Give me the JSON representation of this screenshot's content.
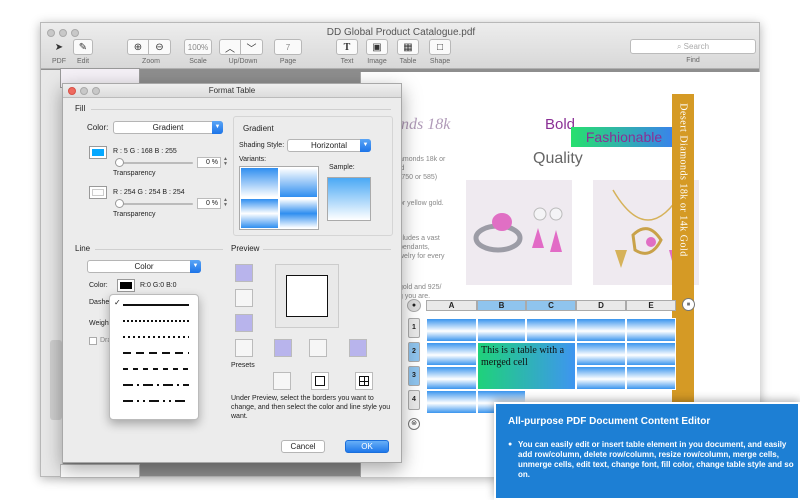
{
  "window": {
    "title": "DD Global Product Catalogue.pdf"
  },
  "toolbar": {
    "items": [
      {
        "label": "PDF"
      },
      {
        "label": "Edit"
      },
      {
        "label": "Zoom"
      },
      {
        "label": "Scale",
        "value": "100%"
      },
      {
        "label": "Up/Down"
      },
      {
        "label": "Page",
        "value": "7"
      },
      {
        "label": "Text"
      },
      {
        "label": "Image"
      },
      {
        "label": "Table"
      },
      {
        "label": "Shape"
      },
      {
        "label": "Find"
      }
    ],
    "search_placeholder": "Search"
  },
  "page": {
    "partial_heading": "nds 18k",
    "bold_word": "Bold",
    "fashionable": "Fashionable",
    "quality": "Quality",
    "side_text": [
      "amonds 18k or",
      "ld",
      "(750 or 585)",
      "or yellow gold.",
      "cludes a vast",
      "pendants,",
      "welry for every",
      "gold and 925/",
      "g you are."
    ],
    "orange_banner": "Desert Diamonds 18k or 14k Gold",
    "table": {
      "columns": [
        "A",
        "B",
        "C",
        "D",
        "E"
      ],
      "selected_columns": [
        "B",
        "C"
      ],
      "rows": [
        "1",
        "2",
        "3",
        "4"
      ],
      "selected_rows": [
        "2",
        "3"
      ],
      "merged_cell_text": "This is a table with a merged cell",
      "pause_symbol": "⏸",
      "add_symbol": "⊜"
    }
  },
  "dialog": {
    "title": "Format Table",
    "fill": {
      "heading": "Fill",
      "color_label": "Color:",
      "color_mode": "Gradient",
      "color1": {
        "text": "R : 5 G : 168 B : 255",
        "hex": "#05a8ff",
        "transparency_label": "Transparency",
        "transparency": "0 %"
      },
      "color2": {
        "text": "R : 254 G : 254 B : 254",
        "hex": "#fefefe",
        "transparency_label": "Transparency",
        "transparency": "0 %"
      },
      "gradient_heading": "Gradient",
      "shading_style_label": "Shading Style:",
      "shading_style": "Horizontal",
      "variants_label": "Variants:",
      "sample_label": "Sample:"
    },
    "line": {
      "heading": "Line",
      "mode": "Color",
      "color_label": "Color:",
      "color_text": "R:0 G:0 B:0",
      "dashed_label": "Dashe",
      "weight_label": "Weight",
      "draw_label": "Dra"
    },
    "preview": {
      "heading": "Preview",
      "presets_label": "Presets",
      "help_text": "Under Preview, select the borders you want to change, and then select the color and line style you want."
    },
    "cancel_label": "Cancel",
    "ok_label": "OK"
  },
  "dash_menu": {
    "selected_index": 0,
    "check": "✓",
    "styles": [
      "solid",
      "dot-fine",
      "dot",
      "dash",
      "dash-short",
      "dash-dot",
      "dash-dot-dot"
    ]
  },
  "promo": {
    "title": "All-purpose PDF Document Content Editor",
    "bullet": "●",
    "body": "You can easily edit or insert table element in you document, and easily add  row/column, delete row/column, resize row/column, merge cells, unmerge cells, edit text, change font, fill color, change table style and so on."
  },
  "colors": {
    "accent": "#1f78ea",
    "promo": "#1d7fd4",
    "orange": "#d59a25",
    "purple_text": "#8a2f95"
  }
}
